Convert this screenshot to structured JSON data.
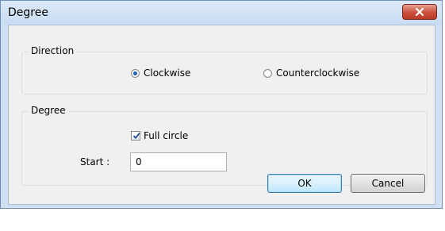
{
  "window": {
    "title": "Degree"
  },
  "direction_group": {
    "label": "Direction",
    "options": [
      {
        "label": "Clockwise",
        "selected": true
      },
      {
        "label": "Counterclockwise",
        "selected": false
      }
    ]
  },
  "degree_group": {
    "label": "Degree",
    "full_circle_label": "Full circle",
    "full_circle_checked": true,
    "start_label": "Start :",
    "start_value": "0"
  },
  "buttons": {
    "ok": "OK",
    "cancel": "Cancel"
  },
  "colors": {
    "titlebar": "#cfe0f3",
    "client": "#f0f0f0",
    "close_button": "#c94f3b",
    "radio_selected": "#1c5fb5"
  }
}
